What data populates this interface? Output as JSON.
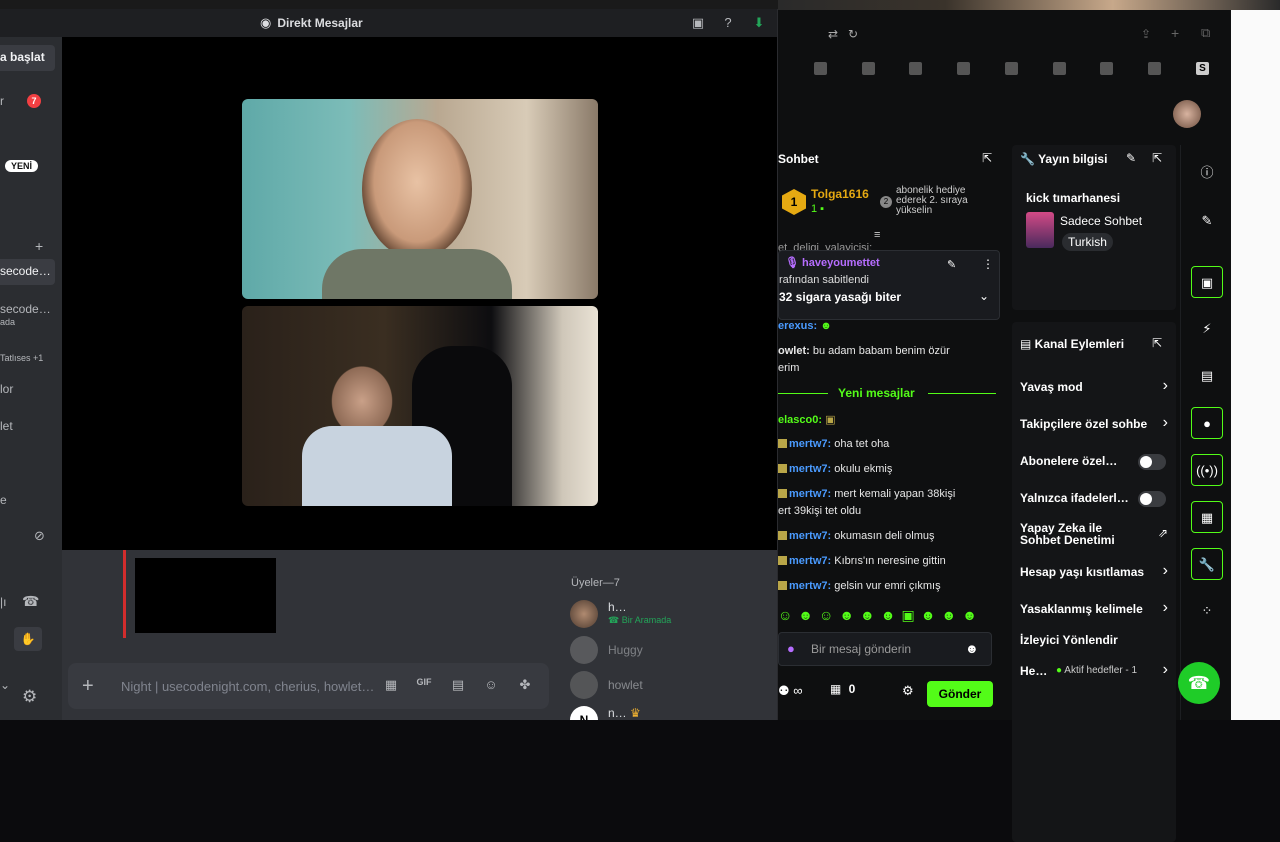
{
  "discord": {
    "window_title": "Direkt Mesajlar",
    "sidebar": {
      "start_label": "a başlat",
      "item_r": "r",
      "badge_count": "7",
      "new_badge": "YENİ",
      "active_item": "secode…",
      "item2": "secode…",
      "item2_sub": "ada",
      "item3": "Tatlıses +1",
      "item4": "lor",
      "item5": "let",
      "item6": "e"
    },
    "members_header": "Üyeler—7",
    "members": [
      {
        "name": "h…",
        "status": "Bir Aramada"
      },
      {
        "name": "Huggy",
        "status": ""
      },
      {
        "name": "howlet",
        "status": ""
      },
      {
        "name": "n…",
        "status": ""
      }
    ],
    "chat_placeholder": "Night | usecodenight.com, cherius, howlet…"
  },
  "kick": {
    "chat": {
      "title": "Sohbet",
      "top_gifter": {
        "rank": "1",
        "name": "Tolga1616",
        "count": "1"
      },
      "sub_info": {
        "number": "2",
        "text": "abonelik hediye ederek 2. sıraya yükselin"
      },
      "partial_line": "et_deligi_yalayicisi:",
      "pinned": {
        "user": "haveyoumettet",
        "by": "rafından sabitlendi",
        "text": "32 sigara yasağı biter"
      },
      "messages": [
        {
          "user": "erexus:",
          "text": ""
        },
        {
          "user": "owlet:",
          "text": "bu adam babam benim özür"
        },
        {
          "user": "",
          "text": "erim"
        }
      ],
      "new_messages_label": "Yeni mesajlar",
      "messages_after": [
        {
          "user": "elasco0:",
          "text": ""
        },
        {
          "user": "mertw7:",
          "text": "oha tet oha"
        },
        {
          "user": "mertw7:",
          "text": "okulu ekmiş"
        },
        {
          "user": "mertw7:",
          "text": "mert kemali yapan 38kişi"
        },
        {
          "user": "",
          "text": "ert 39kişi tet oldu"
        },
        {
          "user": "mertw7:",
          "text": "okumasın deli olmuş"
        },
        {
          "user": "mertw7:",
          "text": "Kıbrıs'ın neresine gittin"
        },
        {
          "user": "mertw7:",
          "text": "gelsin vur emri çıkmış"
        }
      ],
      "input_placeholder": "Bir mesaj gönderin",
      "points": "0",
      "send_label": "Gönder"
    },
    "stream_info": {
      "title": "Yayın bilgisi",
      "stream_title": "kick tımarhanesi",
      "category": "Sadece Sohbet",
      "tag": "Turkish"
    },
    "channel_actions": {
      "title": "Kanal Eylemleri",
      "items": [
        {
          "label": "Yavaş mod",
          "control": "chevron"
        },
        {
          "label": "Takipçilere özel sohbe",
          "control": "chevron"
        },
        {
          "label": "Abonelere özel…",
          "control": "toggle"
        },
        {
          "label": "Yalnızca ifadelerl…",
          "control": "toggle"
        },
        {
          "label": "Yapay Zeka ile Sohbet Denetimi",
          "control": "external"
        },
        {
          "label": "Hesap yaşı kısıtlamas",
          "control": "chevron"
        },
        {
          "label": "Yasaklanmış kelimele",
          "control": "chevron"
        },
        {
          "label": "İzleyici Yönlendir",
          "control": "none"
        },
        {
          "label": "He…",
          "control": "chevron",
          "extra": "Aktif hedefler - 1"
        }
      ]
    }
  }
}
